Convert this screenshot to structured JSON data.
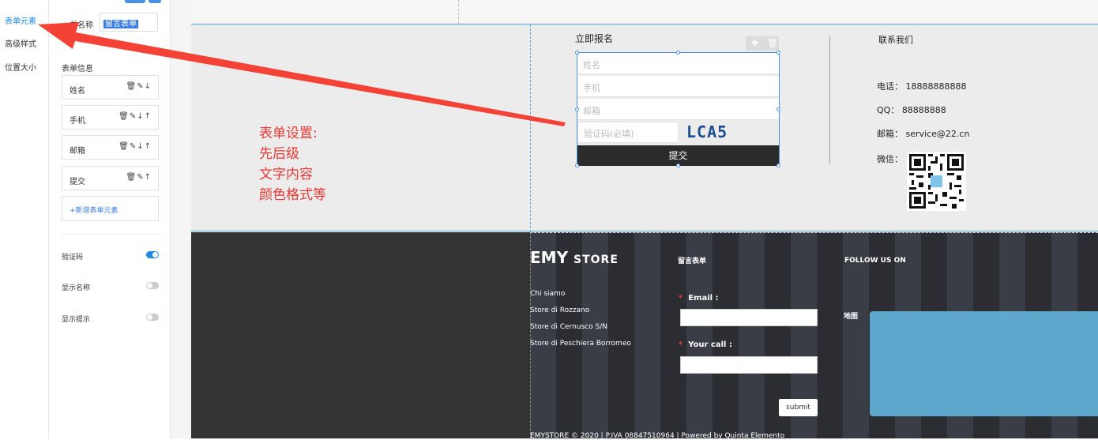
{
  "tabs": [
    "表单元素",
    "高级样式",
    "位置大小"
  ],
  "panel": {
    "name_label": "单名称",
    "name_value": "留言表单",
    "section_label": "表单信息",
    "items": [
      {
        "label": "姓名",
        "ops": "🗑✎↓"
      },
      {
        "label": "手机",
        "ops": "🗑✎↓↑"
      },
      {
        "label": "邮箱",
        "ops": "🗑✎↓↑"
      },
      {
        "label": "提交",
        "ops": "🗑✎↑"
      }
    ],
    "add_label": "+新增表单元素",
    "toggles": [
      {
        "label": "验证码",
        "on": true
      },
      {
        "label": "显示名称",
        "on": false
      },
      {
        "label": "显示提示",
        "on": false
      }
    ]
  },
  "annotation": "表单设置:\n先后级\n文字内容\n颜色格式等",
  "signup": {
    "title": "立即报名",
    "placeholders": [
      "姓名",
      "手机",
      "邮箱"
    ],
    "captcha_placeholder": "验证码(必填)",
    "captcha_text": "LCA5",
    "submit": "提交"
  },
  "contact": {
    "title": "联系我们",
    "phone": "电话：  18888888888",
    "qq": "QQ：   88888888",
    "email": "邮箱：  service@22.cn",
    "wechat": "微信："
  },
  "footer": {
    "logo_main": "EMY",
    "logo_sub": "STORE",
    "links": [
      "Chi siamo",
      "Store di Rozzano",
      "Store di Cernusco S/N",
      "Store di Peschiera Borromeo"
    ],
    "form_title": "留言表单",
    "email_label": "Email :",
    "call_label": "Your call :",
    "submit": "submit",
    "follow": "FOLLOW US ON",
    "map_label": "地图",
    "copyright": "EMYSTORE © 2020 | P.IVA 08847510964 | Powered by Quinta Elemento"
  },
  "colors": {
    "accent": "#1e88e5",
    "annotation": "#e53935",
    "footer_bg": "#333333",
    "map": "#5fa8cd"
  }
}
